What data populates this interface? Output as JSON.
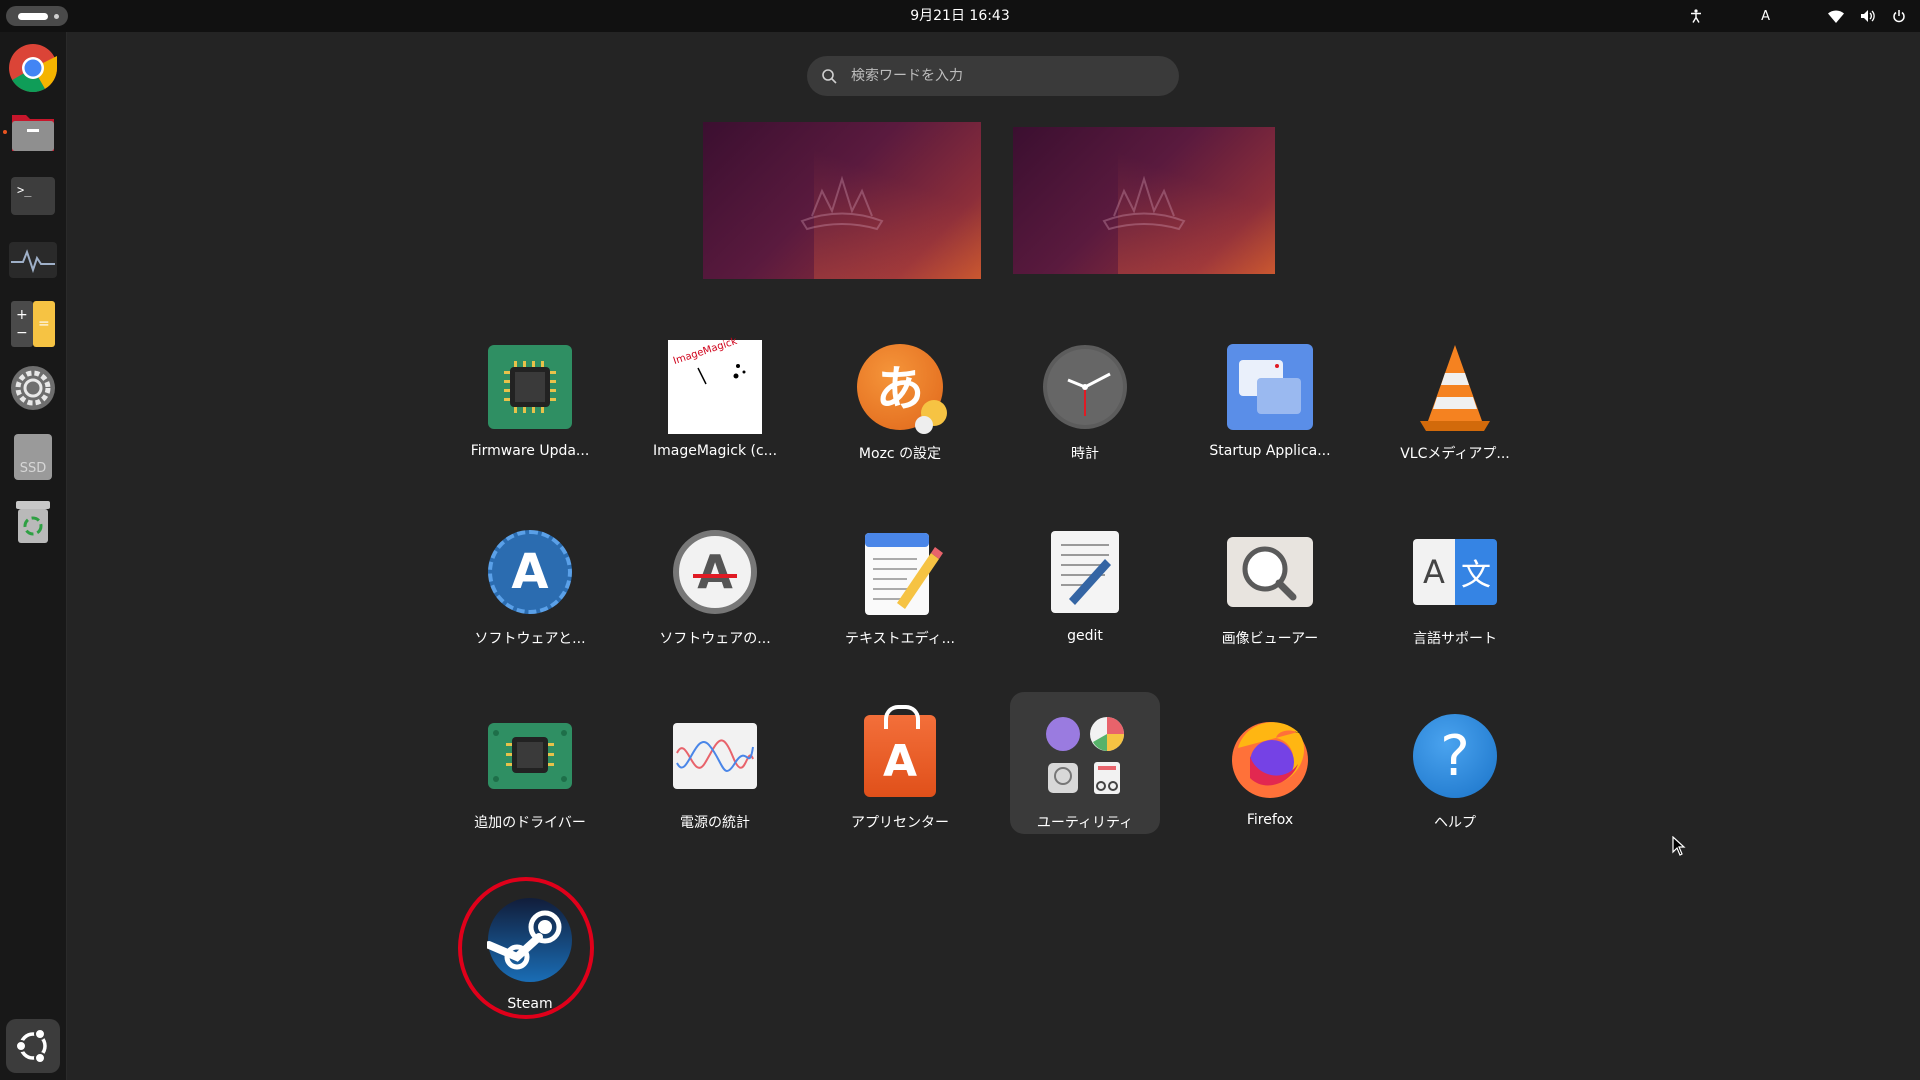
{
  "topbar": {
    "datetime": "9月21日  16:43",
    "input_indicator": "A",
    "icons": [
      "activities-indicator",
      "accessibility-icon",
      "input-method-icon",
      "wifi-icon",
      "volume-icon",
      "power-icon"
    ]
  },
  "dock": {
    "items": [
      {
        "name": "chrome",
        "icon": "chrome-icon",
        "running": false
      },
      {
        "name": "files",
        "icon": "files-icon",
        "running": true
      },
      {
        "name": "terminal",
        "icon": "terminal-icon",
        "running": false
      },
      {
        "name": "system-monitor",
        "icon": "system-monitor-icon",
        "running": false
      },
      {
        "name": "calculator",
        "icon": "calculator-icon",
        "running": false
      },
      {
        "name": "settings",
        "icon": "settings-gear-icon",
        "running": false
      },
      {
        "name": "ssd-drive",
        "icon": "ssd-drive-icon",
        "label": "SSD",
        "running": false
      },
      {
        "name": "trash",
        "icon": "trash-icon",
        "running": false
      },
      {
        "name": "show-apps",
        "icon": "ubuntu-logo-icon",
        "running": false
      }
    ]
  },
  "search": {
    "placeholder": "検索ワードを入力",
    "value": ""
  },
  "workspaces": [
    {
      "name": "workspace-1",
      "active": true
    },
    {
      "name": "workspace-2",
      "active": false
    }
  ],
  "apps": [
    {
      "label": "Firmware Upda...",
      "icon": "firmware-chip-icon"
    },
    {
      "label": "ImageMagick (c...",
      "icon": "imagemagick-icon",
      "icon_text": "ImageMagick"
    },
    {
      "label": "Mozc の設定",
      "icon": "mozc-icon",
      "icon_text": "あ"
    },
    {
      "label": "時計",
      "icon": "clock-icon"
    },
    {
      "label": "Startup Applica...",
      "icon": "startup-apps-icon"
    },
    {
      "label": "VLCメディアプ...",
      "icon": "vlc-cone-icon"
    },
    {
      "label": "ソフトウェアと...",
      "icon": "software-updates-icon",
      "icon_text": "A"
    },
    {
      "label": "ソフトウェアの...",
      "icon": "software-updater-icon",
      "icon_text": "A"
    },
    {
      "label": "テキストエディ...",
      "icon": "text-editor-icon"
    },
    {
      "label": "gedit",
      "icon": "gedit-icon"
    },
    {
      "label": "画像ビューアー",
      "icon": "image-viewer-icon"
    },
    {
      "label": "言語サポート",
      "icon": "language-support-icon",
      "icon_text_left": "A",
      "icon_text_right": "文"
    },
    {
      "label": "追加のドライバー",
      "icon": "drivers-chip-icon"
    },
    {
      "label": "電源の統計",
      "icon": "power-stats-icon"
    },
    {
      "label": "アプリセンター",
      "icon": "app-center-icon",
      "icon_text": "A"
    },
    {
      "label": "ユーティリティ",
      "icon": "utilities-folder-icon"
    },
    {
      "label": "Firefox",
      "icon": "firefox-icon"
    },
    {
      "label": "ヘルプ",
      "icon": "help-icon",
      "icon_text": "?"
    },
    {
      "label": "Steam",
      "icon": "steam-icon",
      "highlighted": true
    }
  ],
  "colors": {
    "accent": "#e95420",
    "highlight_circle": "#e0001a",
    "background": "#242424"
  }
}
